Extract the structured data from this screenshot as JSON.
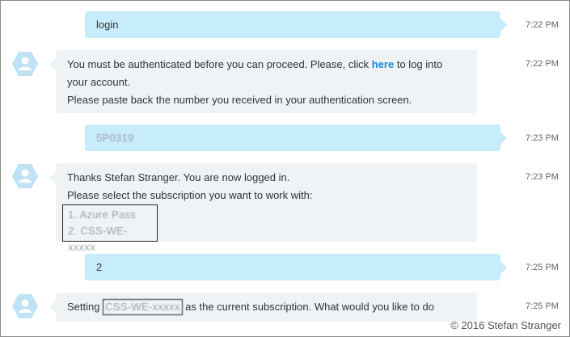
{
  "messages": [
    {
      "type": "outgoing",
      "text": "login",
      "time": "7:22 PM"
    },
    {
      "type": "incoming",
      "line1_pre": "You must be authenticated before you can proceed. Please, click ",
      "line1_link": "here",
      "line1_post": " to log into",
      "line2": "your account.",
      "line3": "Please paste back the number you received in your authentication screen.",
      "time": "7:22 PM"
    },
    {
      "type": "outgoing",
      "text": "5P0319",
      "time": "7:23 PM"
    },
    {
      "type": "incoming",
      "line1": "Thanks Stefan Stranger. You are now logged in.",
      "line2": "Please select the subscription you want to work with:",
      "option1": "1. Azure Pass",
      "option2": "2. CSS-WE-xxxxx",
      "time": "7:23 PM"
    },
    {
      "type": "outgoing",
      "text": "2",
      "time": "7:25 PM"
    },
    {
      "type": "incoming",
      "pre": "Setting ",
      "redacted": "CSS-WE-xxxxx",
      "post": " as the current subscription. What would you like to do",
      "time": "7:25 PM"
    }
  ],
  "copyright": "© 2016 Stefan Stranger",
  "colors": {
    "outgoing_bubble": "#c7ecfb",
    "incoming_bubble": "#f0f3f6",
    "avatar": "#bfe3f5",
    "link": "#1e88d5"
  }
}
